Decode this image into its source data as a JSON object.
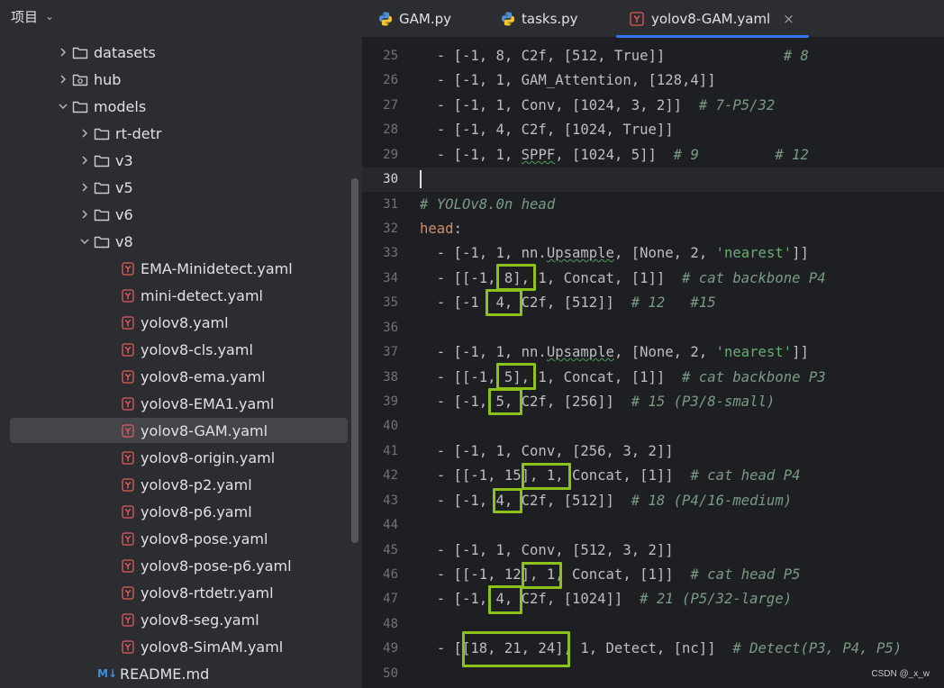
{
  "project": {
    "title": "项目"
  },
  "tree": [
    {
      "label": "datasets",
      "type": "folder",
      "expanded": false,
      "depth": 1
    },
    {
      "label": "hub",
      "type": "folder-special",
      "expanded": false,
      "depth": 1
    },
    {
      "label": "models",
      "type": "folder",
      "expanded": true,
      "depth": 1
    },
    {
      "label": "rt-detr",
      "type": "folder",
      "expanded": false,
      "depth": 2
    },
    {
      "label": "v3",
      "type": "folder",
      "expanded": false,
      "depth": 2
    },
    {
      "label": "v5",
      "type": "folder",
      "expanded": false,
      "depth": 2
    },
    {
      "label": "v6",
      "type": "folder",
      "expanded": false,
      "depth": 2
    },
    {
      "label": "v8",
      "type": "folder",
      "expanded": true,
      "depth": 2
    },
    {
      "label": "EMA-Minidetect.yaml",
      "type": "yaml",
      "depth": 3
    },
    {
      "label": "mini-detect.yaml",
      "type": "yaml",
      "depth": 3
    },
    {
      "label": "yolov8.yaml",
      "type": "yaml",
      "depth": 3
    },
    {
      "label": "yolov8-cls.yaml",
      "type": "yaml",
      "depth": 3
    },
    {
      "label": "yolov8-ema.yaml",
      "type": "yaml",
      "depth": 3
    },
    {
      "label": "yolov8-EMA1.yaml",
      "type": "yaml",
      "depth": 3
    },
    {
      "label": "yolov8-GAM.yaml",
      "type": "yaml",
      "depth": 3,
      "selected": true
    },
    {
      "label": "yolov8-origin.yaml",
      "type": "yaml",
      "depth": 3
    },
    {
      "label": "yolov8-p2.yaml",
      "type": "yaml",
      "depth": 3
    },
    {
      "label": "yolov8-p6.yaml",
      "type": "yaml",
      "depth": 3
    },
    {
      "label": "yolov8-pose.yaml",
      "type": "yaml",
      "depth": 3
    },
    {
      "label": "yolov8-pose-p6.yaml",
      "type": "yaml",
      "depth": 3
    },
    {
      "label": "yolov8-rtdetr.yaml",
      "type": "yaml",
      "depth": 3
    },
    {
      "label": "yolov8-seg.yaml",
      "type": "yaml",
      "depth": 3
    },
    {
      "label": "yolov8-SimAM.yaml",
      "type": "yaml",
      "depth": 3
    },
    {
      "label": "README.md",
      "type": "md",
      "depth": 2
    }
  ],
  "tabs": [
    {
      "label": "GAM.py",
      "icon": "python-icon"
    },
    {
      "label": "tasks.py",
      "icon": "python-icon"
    },
    {
      "label": "yolov8-GAM.yaml",
      "icon": "yaml-icon",
      "active": true,
      "close": "×"
    }
  ],
  "editor": {
    "current_line": 30,
    "lines": [
      {
        "n": 25,
        "parts": [
          [
            "",
            "  - [-1, 8, C2f, [512, True]]"
          ],
          [
            "cm",
            "              # 8"
          ]
        ]
      },
      {
        "n": 26,
        "parts": [
          [
            "",
            "  - [-1, 1, GAM_Attention, [128,4]]"
          ]
        ]
      },
      {
        "n": 27,
        "parts": [
          [
            "",
            "  - [-1, 1, Conv, [1024, 3, 2]]  "
          ],
          [
            "cm",
            "# 7-P5/32"
          ]
        ]
      },
      {
        "n": 28,
        "parts": [
          [
            "",
            "  - [-1, 4, C2f, [1024, True]]"
          ]
        ]
      },
      {
        "n": 29,
        "parts": [
          [
            "",
            "  - [-1, 1, "
          ],
          [
            "typo",
            "SPPF"
          ],
          [
            "",
            ", [1024, 5]]  "
          ],
          [
            "cm",
            "# 9         # 12"
          ]
        ]
      },
      {
        "n": 30,
        "parts": []
      },
      {
        "n": 31,
        "parts": [
          [
            "cm",
            "# YOLOv8.0n head"
          ]
        ]
      },
      {
        "n": 32,
        "parts": [
          [
            "ky",
            "head"
          ],
          [
            "",
            ":"
          ]
        ]
      },
      {
        "n": 33,
        "parts": [
          [
            "",
            "  - [-1, 1, nn."
          ],
          [
            "typo",
            "Upsample"
          ],
          [
            "",
            ", [None, 2, "
          ],
          [
            "st",
            "'nearest'"
          ],
          [
            "",
            "]]"
          ]
        ]
      },
      {
        "n": 34,
        "parts": [
          [
            "",
            "  - [[-1, 8], 1, Concat, [1]]  "
          ],
          [
            "cm",
            "# cat backbone P4"
          ]
        ]
      },
      {
        "n": 35,
        "parts": [
          [
            "",
            "  - [-1  4, C2f, [512]]  "
          ],
          [
            "cm",
            "# 12   #15"
          ]
        ]
      },
      {
        "n": 36,
        "parts": []
      },
      {
        "n": 37,
        "parts": [
          [
            "",
            "  - [-1, 1, nn."
          ],
          [
            "typo",
            "Upsample"
          ],
          [
            "",
            ", [None, 2, "
          ],
          [
            "st",
            "'nearest'"
          ],
          [
            "",
            "]]"
          ]
        ]
      },
      {
        "n": 38,
        "parts": [
          [
            "",
            "  - [[-1, 5], 1, Concat, [1]]  "
          ],
          [
            "cm",
            "# cat backbone P3"
          ]
        ]
      },
      {
        "n": 39,
        "parts": [
          [
            "",
            "  - [-1, 5, C2f, [256]]  "
          ],
          [
            "cm",
            "# 15 (P3/8-small)"
          ]
        ]
      },
      {
        "n": 40,
        "parts": []
      },
      {
        "n": 41,
        "parts": [
          [
            "",
            "  - [-1, 1, Conv, [256, 3, 2]]"
          ]
        ]
      },
      {
        "n": 42,
        "parts": [
          [
            "",
            "  - [[-1, 15], 1, Concat, [1]]  "
          ],
          [
            "cm",
            "# cat head P4"
          ]
        ]
      },
      {
        "n": 43,
        "parts": [
          [
            "",
            "  - [-1, 4, C2f, [512]]  "
          ],
          [
            "cm",
            "# 18 (P4/16-medium)"
          ]
        ]
      },
      {
        "n": 44,
        "parts": []
      },
      {
        "n": 45,
        "parts": [
          [
            "",
            "  - [-1, 1, Conv, [512, 3, 2]]"
          ]
        ]
      },
      {
        "n": 46,
        "parts": [
          [
            "",
            "  - [[-1, 12], 1, Concat, [1]]  "
          ],
          [
            "cm",
            "# cat head P5"
          ]
        ]
      },
      {
        "n": 47,
        "parts": [
          [
            "",
            "  - [-1, 4, C2f, [1024]]  "
          ],
          [
            "cm",
            "# 21 (P5/32-large)"
          ]
        ]
      },
      {
        "n": 48,
        "parts": []
      },
      {
        "n": 49,
        "parts": [
          [
            "",
            "  - [[18, 21, 24], 1, Detect, [nc]]  "
          ],
          [
            "cm",
            "# Detect(P3, P4, P5)"
          ]
        ]
      },
      {
        "n": 50,
        "parts": []
      }
    ]
  },
  "highlight_color": "#8cc21a",
  "watermark": "CSDN @_x_w"
}
